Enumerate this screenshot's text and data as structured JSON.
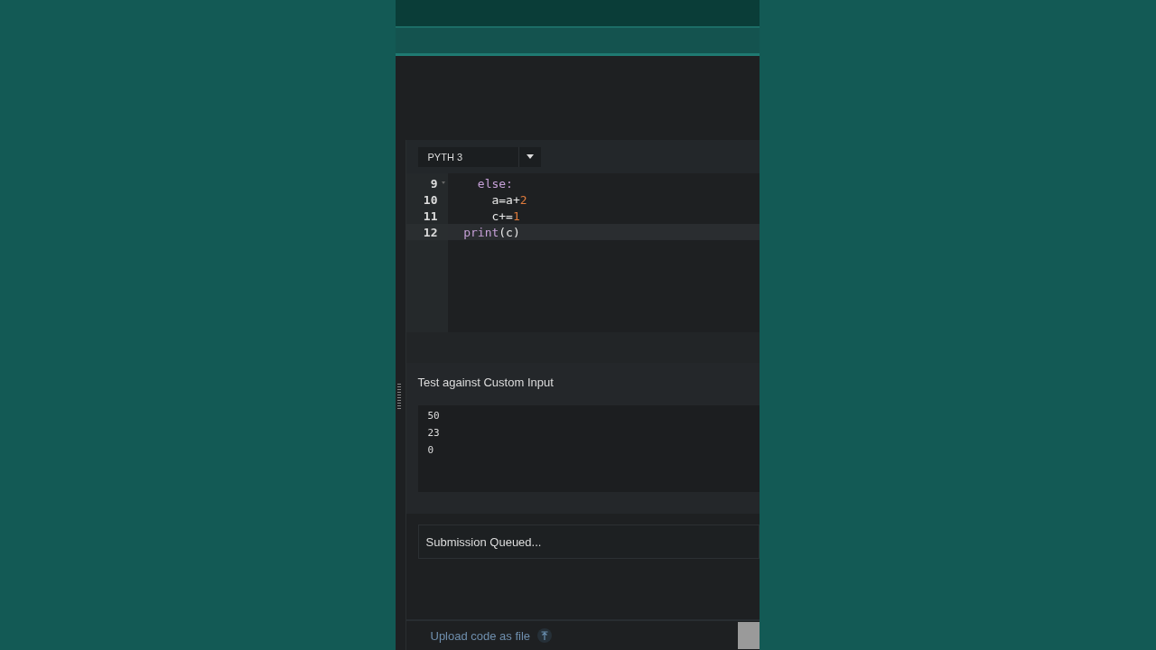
{
  "language_select": {
    "value": "PYTH 3"
  },
  "code_lines": [
    {
      "number": "9",
      "foldable": true,
      "active": false,
      "tokens": [
        {
          "kind": "keyword",
          "text": "    else:"
        }
      ]
    },
    {
      "number": "10",
      "foldable": false,
      "active": false,
      "tokens": [
        {
          "kind": "plain",
          "text": "      a=a+"
        },
        {
          "kind": "number",
          "text": "2"
        }
      ]
    },
    {
      "number": "11",
      "foldable": false,
      "active": false,
      "tokens": [
        {
          "kind": "plain",
          "text": "      c+="
        },
        {
          "kind": "number",
          "text": "1"
        }
      ]
    },
    {
      "number": "12",
      "foldable": false,
      "active": true,
      "tokens": [
        {
          "kind": "keyword",
          "text": "  print"
        },
        {
          "kind": "plain",
          "text": "(c)"
        }
      ]
    }
  ],
  "custom_input": {
    "title": "Test against Custom Input",
    "lines": [
      "50",
      "23",
      "0"
    ]
  },
  "status": "Submission Queued...",
  "upload_link": "Upload code as file"
}
